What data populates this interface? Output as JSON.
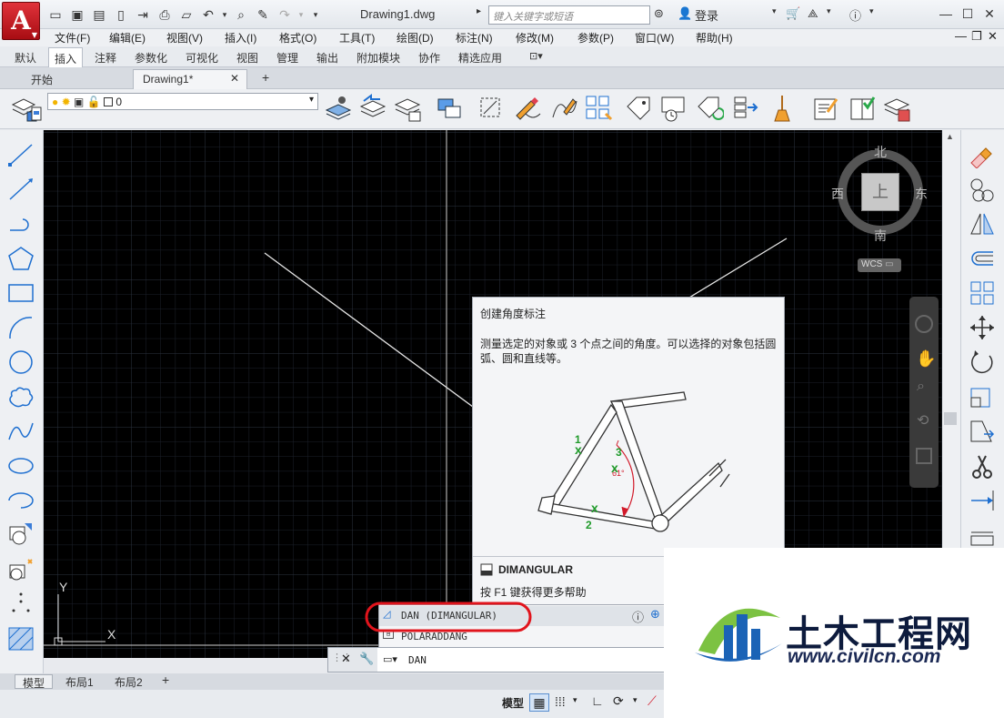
{
  "titlebar": {
    "app_logo": "A",
    "doc_title": "Drawing1.dwg",
    "search_placeholder": "键入关键字或短语",
    "login": "登录"
  },
  "menubar": [
    "文件(F)",
    "编辑(E)",
    "视图(V)",
    "插入(I)",
    "格式(O)",
    "工具(T)",
    "绘图(D)",
    "标注(N)",
    "修改(M)",
    "参数(P)",
    "窗口(W)",
    "帮助(H)"
  ],
  "ribbon_tabs": [
    "默认",
    "插入",
    "注释",
    "参数化",
    "可视化",
    "视图",
    "管理",
    "输出",
    "附加模块",
    "协作",
    "精选应用"
  ],
  "ribbon_active": "插入",
  "file_tabs": {
    "start": "开始",
    "drawing": "Drawing1*"
  },
  "layer": {
    "name": "0"
  },
  "viewcube": {
    "north": "北",
    "south": "南",
    "east": "东",
    "west": "西",
    "top": "上",
    "wcs": "WCS"
  },
  "ucs": {
    "x": "X",
    "y": "Y"
  },
  "tooltip": {
    "title": "创建角度标注",
    "description": "测量选定的对象或 3 个点之间的角度。可以选择的对象包括圆弧、圆和直线等。",
    "diagram": {
      "p1": "1",
      "p2": "2",
      "p3": "3",
      "angle": "61°"
    },
    "command": "DIMANGULAR",
    "help": "按 F1 键获得更多帮助"
  },
  "autocomplete": [
    "DAN (DIMANGULAR)",
    "POLARADDANG"
  ],
  "command_line": {
    "value": "DAN"
  },
  "layout_tabs": [
    "模型",
    "布局1",
    "布局2"
  ],
  "status": {
    "model": "模型"
  },
  "watermark": {
    "title": "土木工程网",
    "url": "www.civilcn.com"
  }
}
